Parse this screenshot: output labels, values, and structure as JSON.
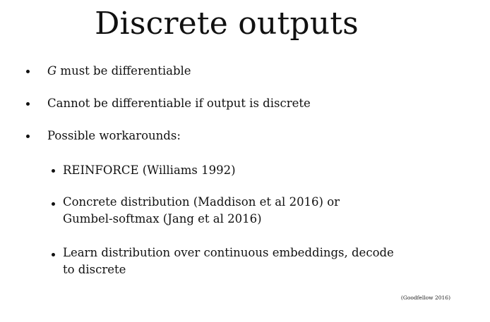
{
  "slide": {
    "title": "Discrete outputs",
    "bullets": {
      "b1_variable": "G",
      "b1_rest": " must be differentiable",
      "b2": "Cannot be differentiable if output is discrete",
      "b3": "Possible workarounds:"
    },
    "sub_bullets": {
      "s1": "REINFORCE (Williams 1992)",
      "s2": "Concrete distribution (Maddison et al 2016) or Gumbel-softmax (Jang et al 2016)",
      "s3": "Learn distribution over continuous embeddings, decode to discrete"
    },
    "citation": "(Goodfellow 2016)"
  }
}
